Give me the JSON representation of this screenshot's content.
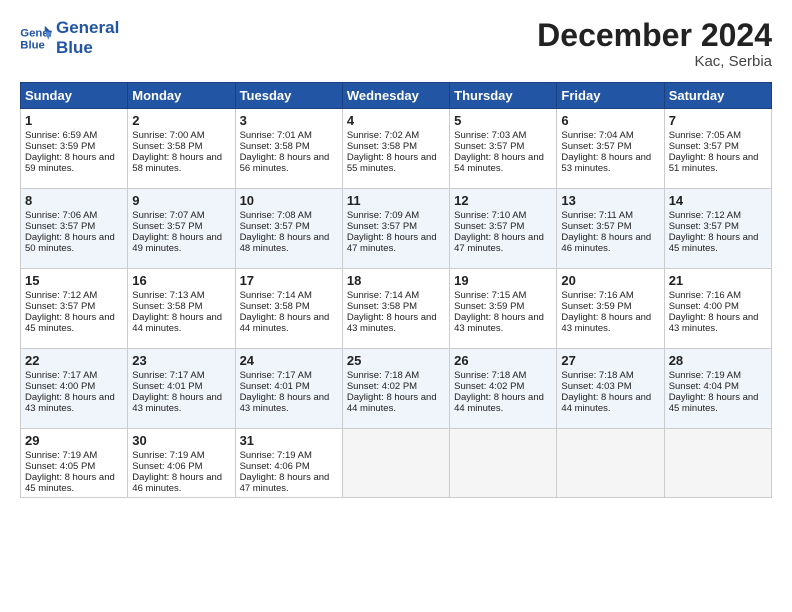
{
  "header": {
    "logo_line1": "General",
    "logo_line2": "Blue",
    "month_title": "December 2024",
    "location": "Kac, Serbia"
  },
  "days_of_week": [
    "Sunday",
    "Monday",
    "Tuesday",
    "Wednesday",
    "Thursday",
    "Friday",
    "Saturday"
  ],
  "weeks": [
    [
      {
        "day": "1",
        "sunrise": "Sunrise: 6:59 AM",
        "sunset": "Sunset: 3:59 PM",
        "daylight": "Daylight: 8 hours and 59 minutes."
      },
      {
        "day": "2",
        "sunrise": "Sunrise: 7:00 AM",
        "sunset": "Sunset: 3:58 PM",
        "daylight": "Daylight: 8 hours and 58 minutes."
      },
      {
        "day": "3",
        "sunrise": "Sunrise: 7:01 AM",
        "sunset": "Sunset: 3:58 PM",
        "daylight": "Daylight: 8 hours and 56 minutes."
      },
      {
        "day": "4",
        "sunrise": "Sunrise: 7:02 AM",
        "sunset": "Sunset: 3:58 PM",
        "daylight": "Daylight: 8 hours and 55 minutes."
      },
      {
        "day": "5",
        "sunrise": "Sunrise: 7:03 AM",
        "sunset": "Sunset: 3:57 PM",
        "daylight": "Daylight: 8 hours and 54 minutes."
      },
      {
        "day": "6",
        "sunrise": "Sunrise: 7:04 AM",
        "sunset": "Sunset: 3:57 PM",
        "daylight": "Daylight: 8 hours and 53 minutes."
      },
      {
        "day": "7",
        "sunrise": "Sunrise: 7:05 AM",
        "sunset": "Sunset: 3:57 PM",
        "daylight": "Daylight: 8 hours and 51 minutes."
      }
    ],
    [
      {
        "day": "8",
        "sunrise": "Sunrise: 7:06 AM",
        "sunset": "Sunset: 3:57 PM",
        "daylight": "Daylight: 8 hours and 50 minutes."
      },
      {
        "day": "9",
        "sunrise": "Sunrise: 7:07 AM",
        "sunset": "Sunset: 3:57 PM",
        "daylight": "Daylight: 8 hours and 49 minutes."
      },
      {
        "day": "10",
        "sunrise": "Sunrise: 7:08 AM",
        "sunset": "Sunset: 3:57 PM",
        "daylight": "Daylight: 8 hours and 48 minutes."
      },
      {
        "day": "11",
        "sunrise": "Sunrise: 7:09 AM",
        "sunset": "Sunset: 3:57 PM",
        "daylight": "Daylight: 8 hours and 47 minutes."
      },
      {
        "day": "12",
        "sunrise": "Sunrise: 7:10 AM",
        "sunset": "Sunset: 3:57 PM",
        "daylight": "Daylight: 8 hours and 47 minutes."
      },
      {
        "day": "13",
        "sunrise": "Sunrise: 7:11 AM",
        "sunset": "Sunset: 3:57 PM",
        "daylight": "Daylight: 8 hours and 46 minutes."
      },
      {
        "day": "14",
        "sunrise": "Sunrise: 7:12 AM",
        "sunset": "Sunset: 3:57 PM",
        "daylight": "Daylight: 8 hours and 45 minutes."
      }
    ],
    [
      {
        "day": "15",
        "sunrise": "Sunrise: 7:12 AM",
        "sunset": "Sunset: 3:57 PM",
        "daylight": "Daylight: 8 hours and 45 minutes."
      },
      {
        "day": "16",
        "sunrise": "Sunrise: 7:13 AM",
        "sunset": "Sunset: 3:58 PM",
        "daylight": "Daylight: 8 hours and 44 minutes."
      },
      {
        "day": "17",
        "sunrise": "Sunrise: 7:14 AM",
        "sunset": "Sunset: 3:58 PM",
        "daylight": "Daylight: 8 hours and 44 minutes."
      },
      {
        "day": "18",
        "sunrise": "Sunrise: 7:14 AM",
        "sunset": "Sunset: 3:58 PM",
        "daylight": "Daylight: 8 hours and 43 minutes."
      },
      {
        "day": "19",
        "sunrise": "Sunrise: 7:15 AM",
        "sunset": "Sunset: 3:59 PM",
        "daylight": "Daylight: 8 hours and 43 minutes."
      },
      {
        "day": "20",
        "sunrise": "Sunrise: 7:16 AM",
        "sunset": "Sunset: 3:59 PM",
        "daylight": "Daylight: 8 hours and 43 minutes."
      },
      {
        "day": "21",
        "sunrise": "Sunrise: 7:16 AM",
        "sunset": "Sunset: 4:00 PM",
        "daylight": "Daylight: 8 hours and 43 minutes."
      }
    ],
    [
      {
        "day": "22",
        "sunrise": "Sunrise: 7:17 AM",
        "sunset": "Sunset: 4:00 PM",
        "daylight": "Daylight: 8 hours and 43 minutes."
      },
      {
        "day": "23",
        "sunrise": "Sunrise: 7:17 AM",
        "sunset": "Sunset: 4:01 PM",
        "daylight": "Daylight: 8 hours and 43 minutes."
      },
      {
        "day": "24",
        "sunrise": "Sunrise: 7:17 AM",
        "sunset": "Sunset: 4:01 PM",
        "daylight": "Daylight: 8 hours and 43 minutes."
      },
      {
        "day": "25",
        "sunrise": "Sunrise: 7:18 AM",
        "sunset": "Sunset: 4:02 PM",
        "daylight": "Daylight: 8 hours and 44 minutes."
      },
      {
        "day": "26",
        "sunrise": "Sunrise: 7:18 AM",
        "sunset": "Sunset: 4:02 PM",
        "daylight": "Daylight: 8 hours and 44 minutes."
      },
      {
        "day": "27",
        "sunrise": "Sunrise: 7:18 AM",
        "sunset": "Sunset: 4:03 PM",
        "daylight": "Daylight: 8 hours and 44 minutes."
      },
      {
        "day": "28",
        "sunrise": "Sunrise: 7:19 AM",
        "sunset": "Sunset: 4:04 PM",
        "daylight": "Daylight: 8 hours and 45 minutes."
      }
    ],
    [
      {
        "day": "29",
        "sunrise": "Sunrise: 7:19 AM",
        "sunset": "Sunset: 4:05 PM",
        "daylight": "Daylight: 8 hours and 45 minutes."
      },
      {
        "day": "30",
        "sunrise": "Sunrise: 7:19 AM",
        "sunset": "Sunset: 4:06 PM",
        "daylight": "Daylight: 8 hours and 46 minutes."
      },
      {
        "day": "31",
        "sunrise": "Sunrise: 7:19 AM",
        "sunset": "Sunset: 4:06 PM",
        "daylight": "Daylight: 8 hours and 47 minutes."
      },
      null,
      null,
      null,
      null
    ]
  ]
}
